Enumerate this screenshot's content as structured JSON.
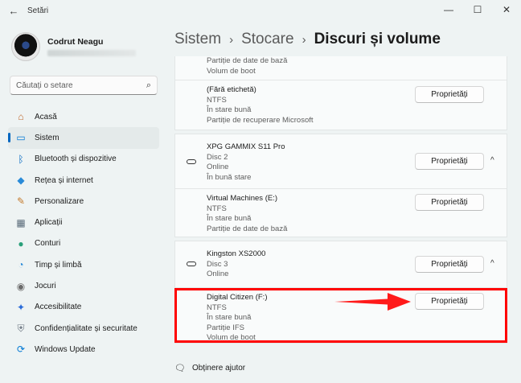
{
  "window": {
    "title": "Setări",
    "back_glyph": "←",
    "minimize_glyph": "—",
    "maximize_glyph": "☐",
    "close_glyph": "✕"
  },
  "profile": {
    "name": "Codrut Neagu"
  },
  "search": {
    "placeholder": "Căutați o setare",
    "icon": "search-icon",
    "glyph": "⌕"
  },
  "nav": {
    "items": [
      {
        "label": "Acasă",
        "icon": "home-icon",
        "glyph": "⌂",
        "color": "#c0672b"
      },
      {
        "label": "Sistem",
        "icon": "system-icon",
        "glyph": "▭",
        "color": "#0078d4"
      },
      {
        "label": "Bluetooth și dispozitive",
        "icon": "bluetooth-icon",
        "glyph": "ᛒ",
        "color": "#0067c0"
      },
      {
        "label": "Rețea și internet",
        "icon": "wifi-icon",
        "glyph": "◆",
        "color": "#2a8bd8"
      },
      {
        "label": "Personalizare",
        "icon": "brush-icon",
        "glyph": "✎",
        "color": "#c47a2b"
      },
      {
        "label": "Aplicații",
        "icon": "apps-icon",
        "glyph": "▦",
        "color": "#5a6b7a"
      },
      {
        "label": "Conturi",
        "icon": "account-icon",
        "glyph": "●",
        "color": "#2aa07a"
      },
      {
        "label": "Timp și limbă",
        "icon": "clock-icon",
        "glyph": "◔",
        "color": "#2a8bd8"
      },
      {
        "label": "Jocuri",
        "icon": "gamepad-icon",
        "glyph": "◉",
        "color": "#6b6b6b"
      },
      {
        "label": "Accesibilitate",
        "icon": "accessibility-icon",
        "glyph": "✦",
        "color": "#2a6bd8"
      },
      {
        "label": "Confidențialitate și securitate",
        "icon": "shield-icon",
        "glyph": "⛨",
        "color": "#6b7580"
      },
      {
        "label": "Windows Update",
        "icon": "update-icon",
        "glyph": "⟳",
        "color": "#0078d4"
      }
    ]
  },
  "breadcrumb": {
    "level1": "Sistem",
    "level2": "Stocare",
    "current": "Discuri și volume",
    "sep": "›"
  },
  "cards": {
    "card1": {
      "partial_lines": [
        "Partiție de date de bază",
        "Volum de boot"
      ],
      "volume": {
        "lines": [
          "(Fără etichetă)",
          "NTFS",
          "În stare bună",
          "Partiție de recuperare Microsoft"
        ],
        "button": "Proprietăți"
      }
    },
    "card2": {
      "disk": {
        "lines": [
          "XPG GAMMIX S11 Pro",
          "Disc 2",
          "Online",
          "În bună stare"
        ],
        "button": "Proprietăți",
        "chevron": "^"
      },
      "volume": {
        "lines": [
          "Virtual Machines (E:)",
          "NTFS",
          "În stare bună",
          "Partiție de date de bază"
        ],
        "button": "Proprietăți"
      }
    },
    "card3": {
      "disk": {
        "lines": [
          "Kingston XS2000",
          "Disc 3",
          "Online"
        ],
        "button": "Proprietăți",
        "chevron": "^"
      },
      "volume": {
        "lines": [
          "Digital Citizen (F:)",
          "NTFS",
          "În stare bună",
          "Partiție IFS",
          "Volum de boot"
        ],
        "button": "Proprietăți"
      }
    }
  },
  "help": {
    "label": "Obținere ajutor",
    "icon": "help-icon",
    "glyph": "🗨"
  },
  "colors": {
    "accent": "#0067c0",
    "highlight": "#ff0000"
  }
}
